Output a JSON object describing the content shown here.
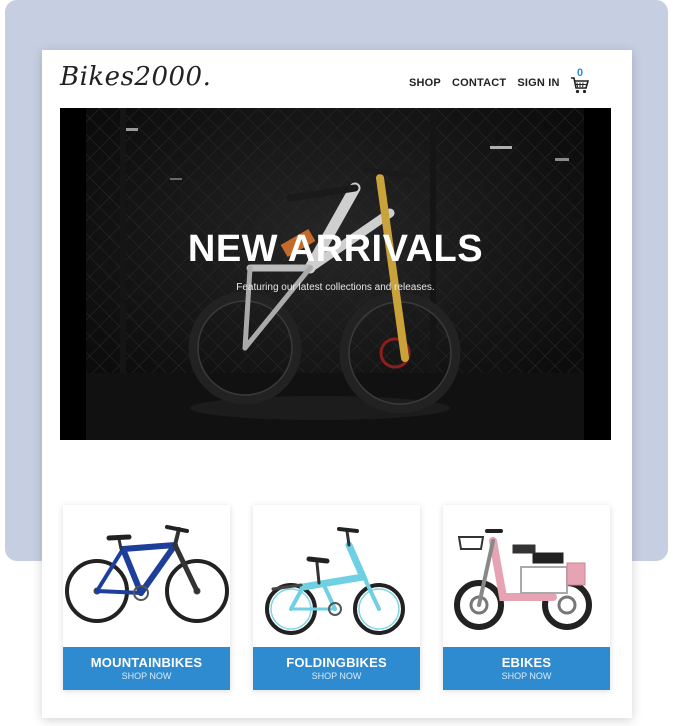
{
  "header": {
    "logo": "Bikes2000.",
    "nav": [
      {
        "label": "SHOP"
      },
      {
        "label": "CONTACT"
      },
      {
        "label": "SIGN IN"
      }
    ],
    "cart": {
      "count": "0",
      "icon": "cart-icon"
    }
  },
  "hero": {
    "title": "NEW ARRIVALS",
    "subtitle": "Featuring our latest collections and releases."
  },
  "categories": [
    {
      "title": "MOUNTAINBIKES",
      "cta": "SHOP NOW"
    },
    {
      "title": "FOLDINGBIKES",
      "cta": "SHOP NOW"
    },
    {
      "title": "EBIKES",
      "cta": "SHOP NOW"
    }
  ],
  "colors": {
    "accent": "#2f8bd0",
    "backdrop": "#c6cfe1"
  }
}
